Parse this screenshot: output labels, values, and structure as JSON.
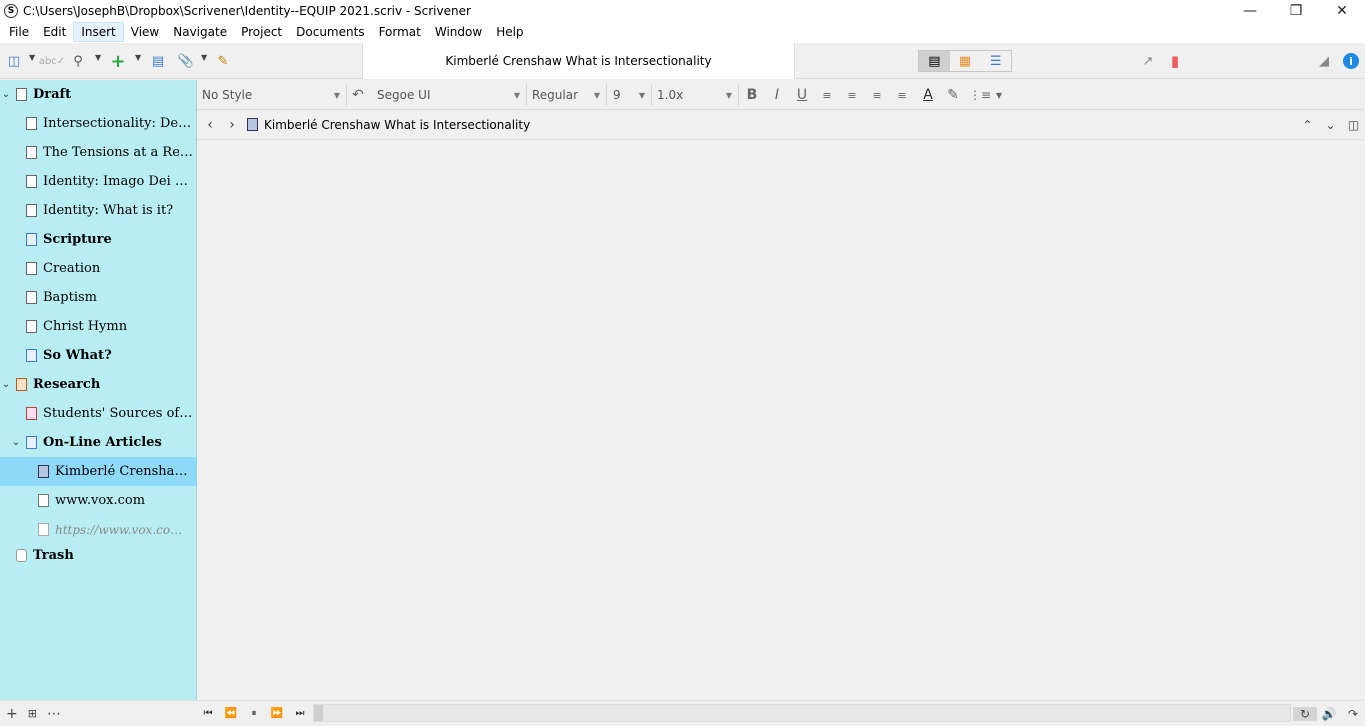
{
  "window": {
    "title": "C:\\Users\\JosephB\\Dropbox\\Scrivener\\Identity--EQUIP 2021.scriv - Scrivener",
    "app_icon_letter": "S"
  },
  "menu": [
    "File",
    "Edit",
    "Insert",
    "View",
    "Navigate",
    "Project",
    "Documents",
    "Format",
    "Window",
    "Help"
  ],
  "toolbar": {
    "document_title": "Kimberlé Crenshaw What is Intersectionality"
  },
  "binder": {
    "items": [
      {
        "label": "Draft",
        "bold": true,
        "expanded": true
      },
      {
        "label": "Intersectionality: Defin…"
      },
      {
        "label": "The Tensions at a Relig…"
      },
      {
        "label": "Identity: Imago Dei + In…"
      },
      {
        "label": "Identity: What is it?"
      },
      {
        "label": "Scripture",
        "bold": true
      },
      {
        "label": "Creation"
      },
      {
        "label": "Baptism"
      },
      {
        "label": "Christ Hymn"
      },
      {
        "label": "So What?",
        "bold": true
      },
      {
        "label": "Research",
        "bold": true,
        "expanded": true
      },
      {
        "label": "Students' Sources of W…"
      },
      {
        "label": "On-Line Articles",
        "bold": true,
        "expanded": true
      },
      {
        "label": "Kimberlé Crenshaw …",
        "selected": true
      },
      {
        "label": "www.vox.com"
      },
      {
        "label": "https://www.vox.com/t…",
        "italic": true
      },
      {
        "label": "Trash",
        "bold": true
      }
    ]
  },
  "format_bar": {
    "style": "No Style",
    "font": "Segoe UI",
    "weight": "Regular",
    "size": "9",
    "line_spacing": "1.0x",
    "bold": "B",
    "italic": "I",
    "underline": "U",
    "text_color": "A"
  },
  "header_bar": {
    "title": "Kimberlé Crenshaw What is Intersectionality"
  },
  "colors": {
    "binder_bg": "#b8eef3",
    "binder_selected": "#8ed8f8",
    "bookmark": "#ef5a5a",
    "info": "#1e88e5"
  }
}
